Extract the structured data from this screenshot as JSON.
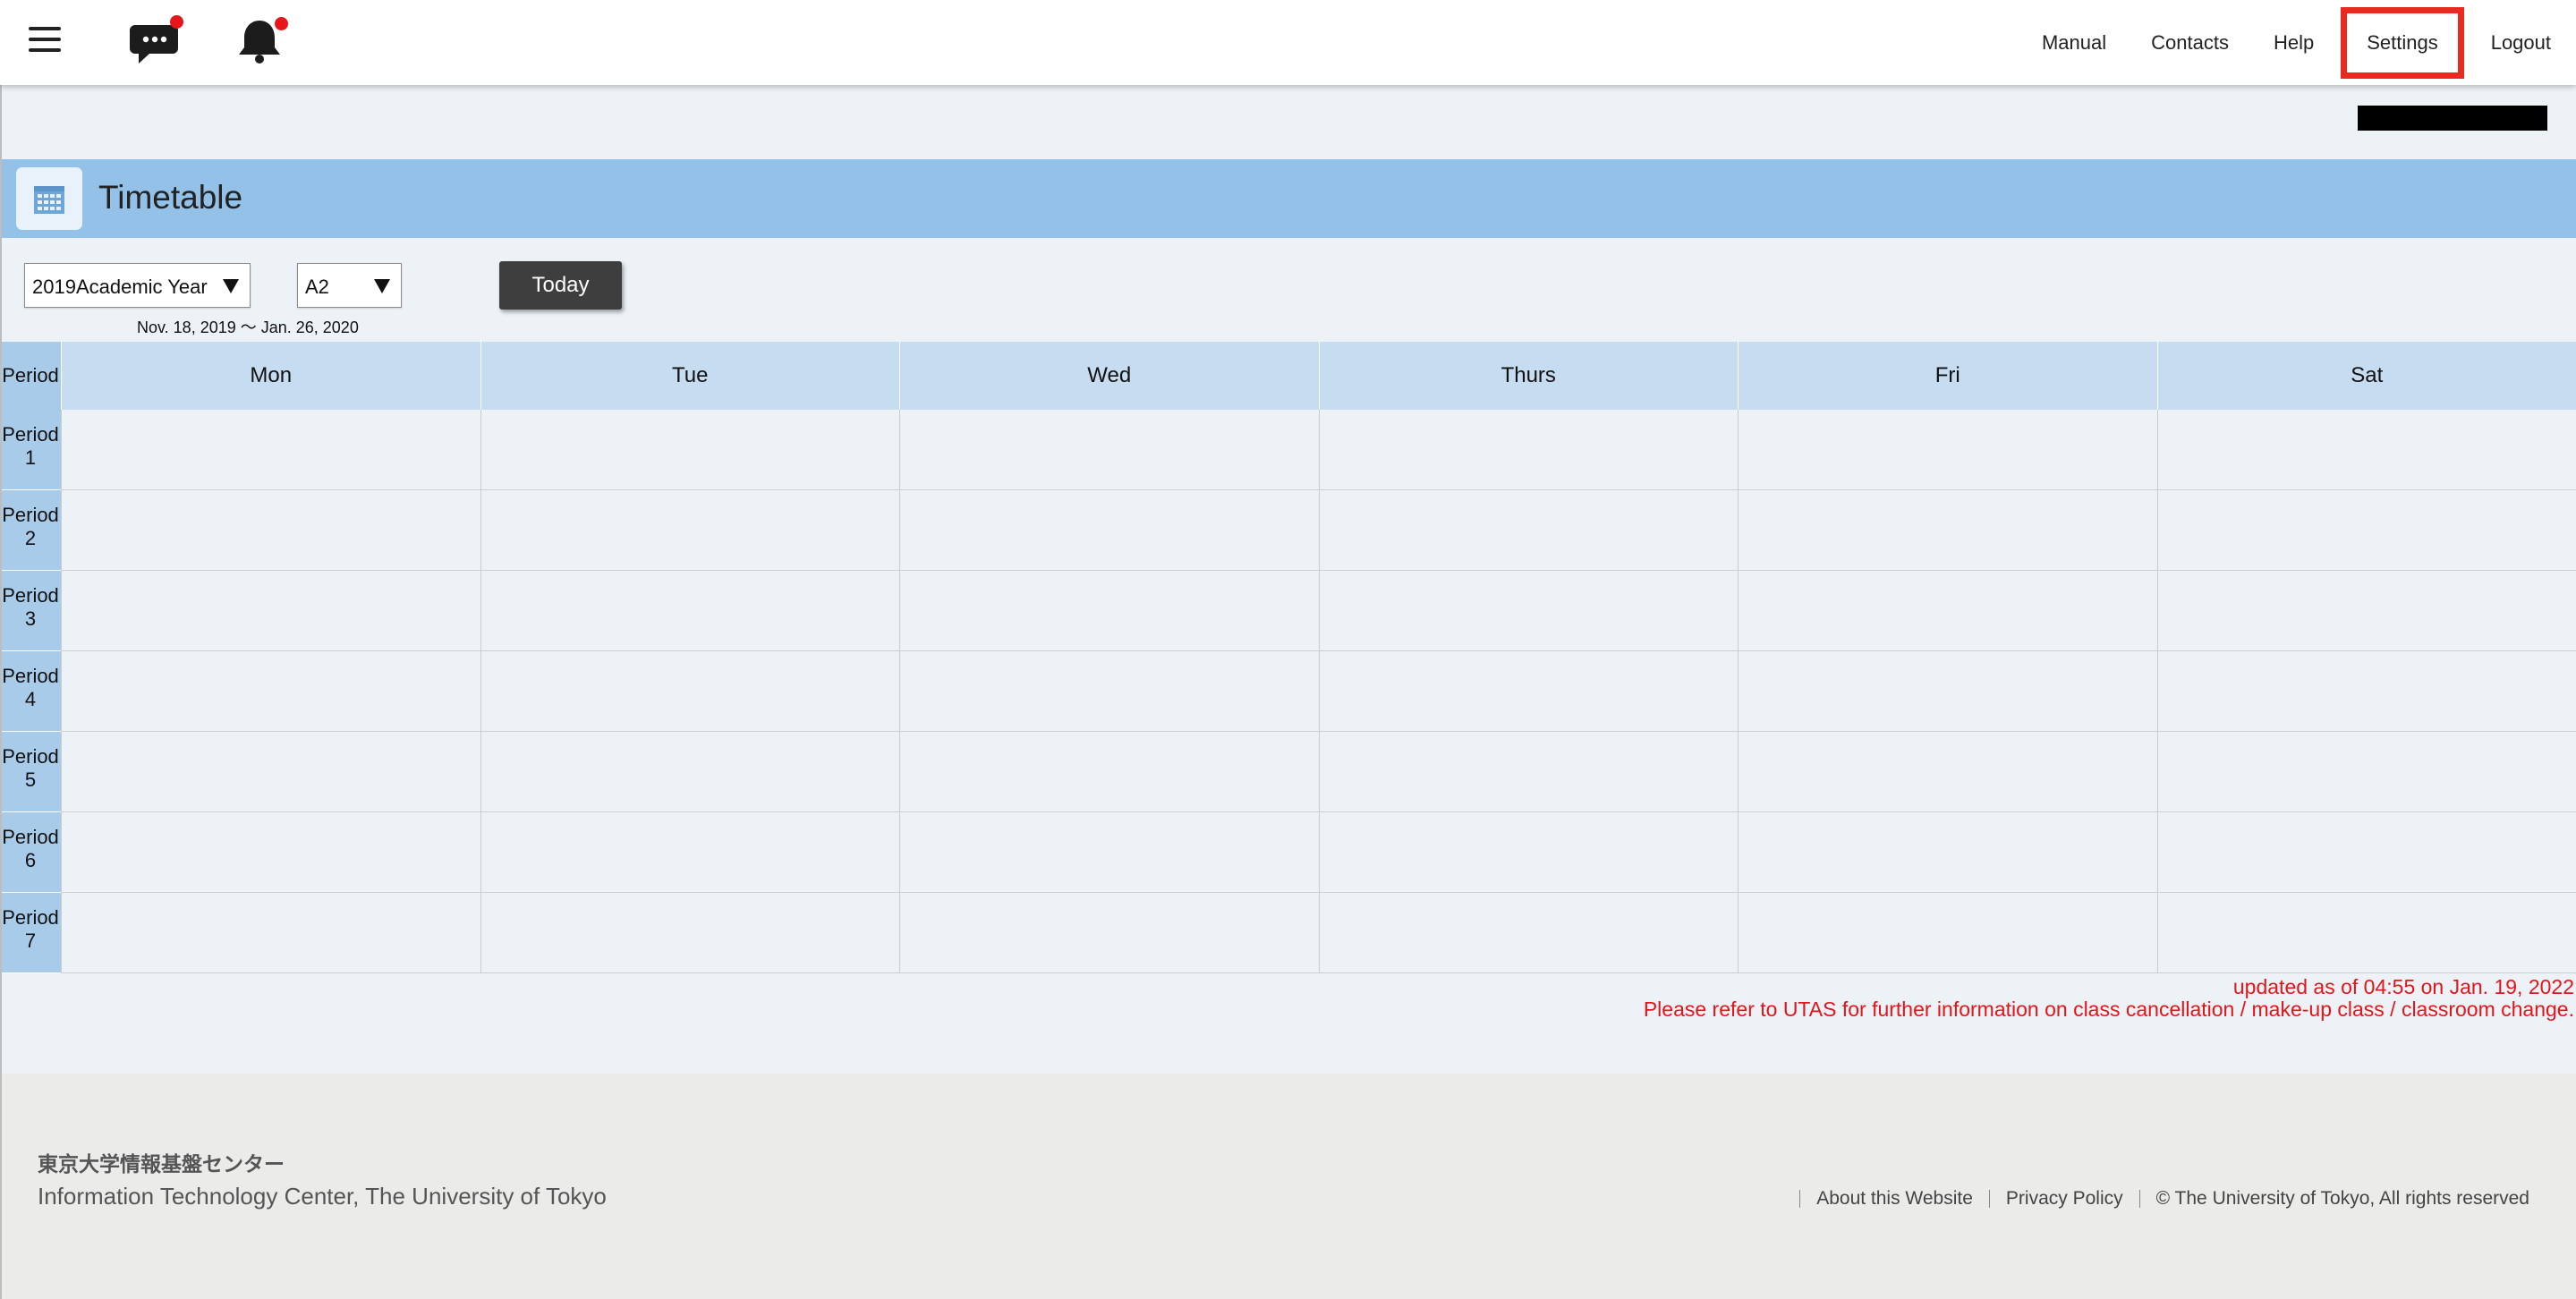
{
  "header": {
    "nav": [
      {
        "label": "Manual"
      },
      {
        "label": "Contacts"
      },
      {
        "label": "Help"
      },
      {
        "label": "Settings"
      },
      {
        "label": "Logout"
      }
    ],
    "icons": {
      "menu": "hamburger-menu-icon",
      "messages": "chat-bubble-icon",
      "notifications": "bell-icon"
    },
    "highlight_color": "#ea2a1e",
    "badge_color": "#e8161b"
  },
  "page": {
    "title": "Timetable",
    "title_icon": "calendar-icon",
    "band_color": "#93c1e8"
  },
  "controls": {
    "year": "2019Academic Year",
    "term": "A2",
    "date_range": "Nov. 18, 2019 〜 Jan. 26, 2020",
    "today_label": "Today"
  },
  "timetable": {
    "period_header": "Period",
    "days": [
      "Mon",
      "Tue",
      "Wed",
      "Thurs",
      "Fri",
      "Sat"
    ],
    "periods": [
      {
        "word": "Period",
        "num": "1"
      },
      {
        "word": "Period",
        "num": "2"
      },
      {
        "word": "Period",
        "num": "3"
      },
      {
        "word": "Period",
        "num": "4"
      },
      {
        "word": "Period",
        "num": "5"
      },
      {
        "word": "Period",
        "num": "6"
      },
      {
        "word": "Period",
        "num": "7"
      }
    ]
  },
  "notices": {
    "updated": "updated as of 04:55 on Jan. 19, 2022",
    "refer": "Please refer to UTAS for further information on class cancellation / make-up class / classroom change.",
    "color": "#e4141b"
  },
  "footer": {
    "org_jp": "東京大学情報基盤センター",
    "org_en": "Information Technology Center, The University of Tokyo",
    "links": [
      {
        "label": "About this Website"
      },
      {
        "label": "Privacy Policy"
      }
    ],
    "copyright": "© The University of Tokyo, All rights reserved"
  }
}
